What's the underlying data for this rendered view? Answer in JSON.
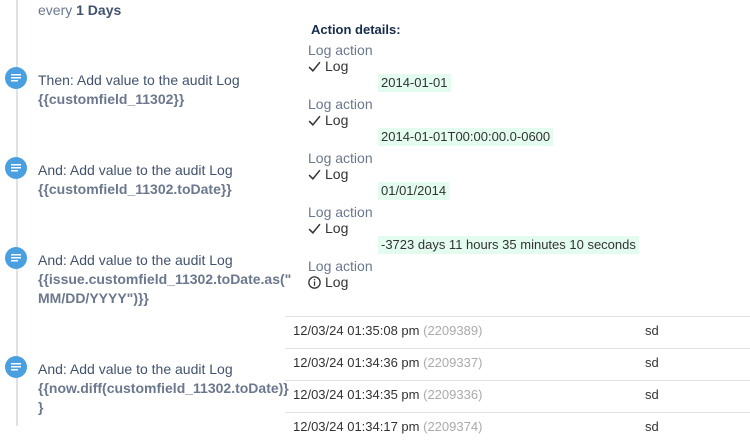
{
  "schedule": {
    "prefix": "every",
    "value": "1 Days"
  },
  "rules": [
    {
      "title": "Then: Add value to the audit Log",
      "code": "{{customfield_11302}}"
    },
    {
      "title": "And: Add value to the audit Log",
      "code": "{{customfield_11302.toDate}}"
    },
    {
      "title": "And: Add value to the audit Log",
      "code": "{{issue.customfield_11302.toDate.as(\"\nMM/DD/YYYY\")}}"
    },
    {
      "title": "And: Add value to the audit Log",
      "code": "{{now.diff(customfield_11302.toDate)}\n}"
    }
  ],
  "details": {
    "heading": "Action details:",
    "logs": [
      {
        "label": "Log action",
        "status": "Log",
        "status_icon": "check-icon",
        "value": "2014-01-01"
      },
      {
        "label": "Log action",
        "status": "Log",
        "status_icon": "check-icon",
        "value": "2014-01-01T00:00:00.0-0600"
      },
      {
        "label": "Log action",
        "status": "Log",
        "status_icon": "check-icon",
        "value": "01/01/2014"
      },
      {
        "label": "Log action",
        "status": "Log",
        "status_icon": "check-icon",
        "value": "-3723 days 11 hours 35 minutes 10 seconds"
      },
      {
        "label": "Log action",
        "status": "Log",
        "status_icon": "info-icon",
        "value": ""
      }
    ]
  },
  "audit": [
    {
      "date": "12/03/24 01:35:08 pm",
      "id": "(2209389)",
      "user": "sd"
    },
    {
      "date": "12/03/24 01:34:36 pm",
      "id": "(2209337)",
      "user": "sd"
    },
    {
      "date": "12/03/24 01:34:35 pm",
      "id": "(2209336)",
      "user": "sd"
    },
    {
      "date": "12/03/24 01:34:17 pm",
      "id": "(2209374)",
      "user": "sd"
    }
  ],
  "colors": {
    "accent": "#4a9fe0",
    "log_value_bg": "#e3fcef"
  }
}
